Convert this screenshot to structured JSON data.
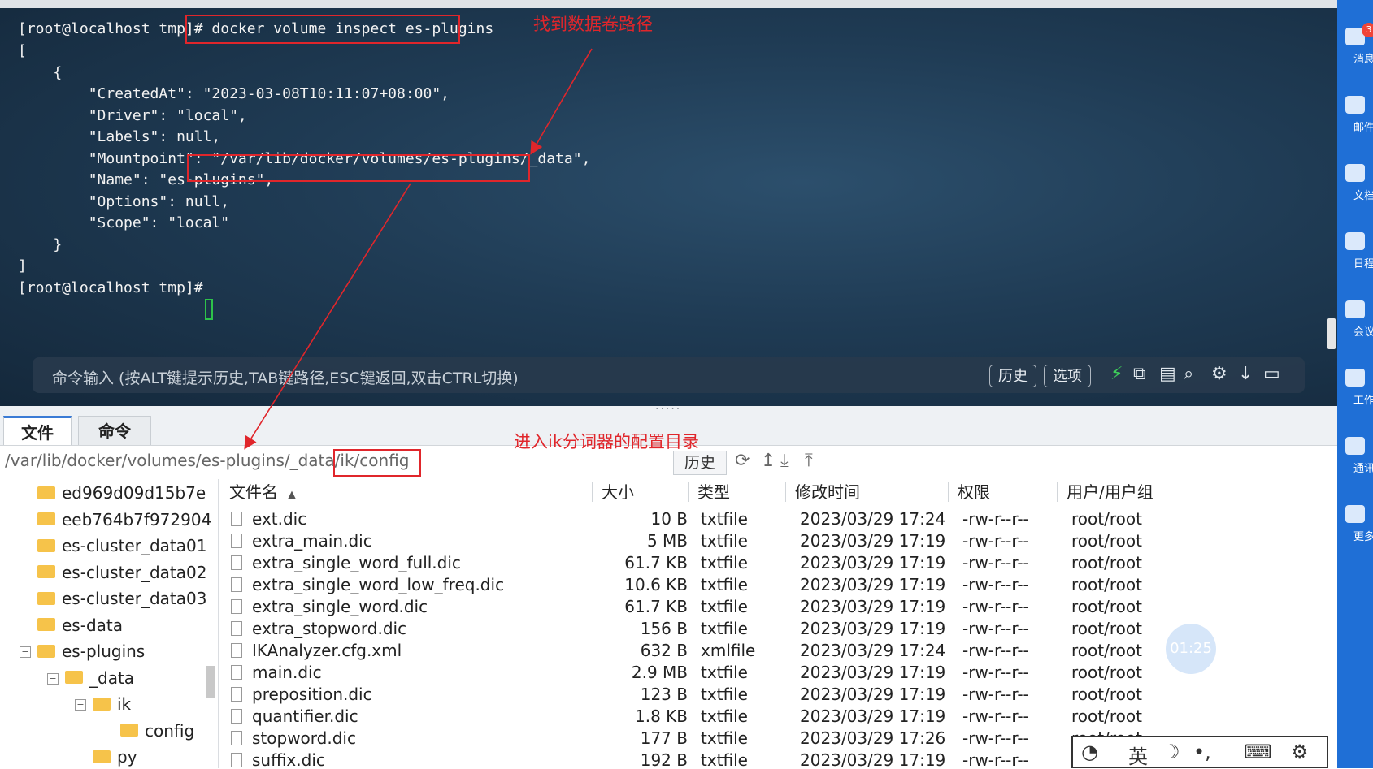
{
  "terminal": {
    "lines": [
      "[root@localhost tmp]# docker volume inspect es-plugins",
      "[",
      "    {",
      "        \"CreatedAt\": \"2023-03-08T10:11:07+08:00\",",
      "        \"Driver\": \"local\",",
      "        \"Labels\": null,",
      "        \"Mountpoint\": \"/var/lib/docker/volumes/es-plugins/_data\",",
      "        \"Name\": \"es-plugins\",",
      "        \"Options\": null,",
      "        \"Scope\": \"local\"",
      "    }",
      "]",
      "[root@localhost tmp]# "
    ],
    "annotation_top": "找到数据卷路径",
    "annotation_path": "进入ik分词器的配置目录",
    "command_placeholder": "命令输入 (按ALT键提示历史,TAB键路径,ESC键返回,双击CTRL切换)",
    "history_button": "历史",
    "options_button": "选项",
    "toolbar_icons": [
      "lightning-icon",
      "copy-icon",
      "paste-icon",
      "search-icon",
      "gear-icon",
      "download-arrow-icon",
      "maximize-icon"
    ]
  },
  "tabs": {
    "files": "文件",
    "commands": "命令"
  },
  "pathbar": {
    "path": "/var/lib/docker/volumes/es-plugins/_data/ik/config",
    "history": "历史"
  },
  "tree": [
    {
      "label": "ed969d09d15b7e"
    },
    {
      "label": "eeb764b7f972904"
    },
    {
      "label": "es-cluster_data01"
    },
    {
      "label": "es-cluster_data02"
    },
    {
      "label": "es-cluster_data03"
    },
    {
      "label": "es-data"
    },
    {
      "label": "es-plugins",
      "expander": "−"
    },
    {
      "label": "_data",
      "expander": "−"
    },
    {
      "label": "ik",
      "expander": "−"
    },
    {
      "label": "config",
      "selected": true
    },
    {
      "label": "py"
    }
  ],
  "filelist": {
    "columns": [
      "文件名",
      "大小",
      "类型",
      "修改时间",
      "权限",
      "用户/用户组"
    ],
    "sort_indicator": "▲",
    "rows": [
      {
        "name": "ext.dic",
        "size": "10 B",
        "type": "txtfile",
        "mtime": "2023/03/29 17:24",
        "perm": "-rw-r--r--",
        "owner": "root/root"
      },
      {
        "name": "extra_main.dic",
        "size": "5 MB",
        "type": "txtfile",
        "mtime": "2023/03/29 17:19",
        "perm": "-rw-r--r--",
        "owner": "root/root"
      },
      {
        "name": "extra_single_word_full.dic",
        "size": "61.7 KB",
        "type": "txtfile",
        "mtime": "2023/03/29 17:19",
        "perm": "-rw-r--r--",
        "owner": "root/root"
      },
      {
        "name": "extra_single_word_low_freq.dic",
        "size": "10.6 KB",
        "type": "txtfile",
        "mtime": "2023/03/29 17:19",
        "perm": "-rw-r--r--",
        "owner": "root/root"
      },
      {
        "name": "extra_single_word.dic",
        "size": "61.7 KB",
        "type": "txtfile",
        "mtime": "2023/03/29 17:19",
        "perm": "-rw-r--r--",
        "owner": "root/root"
      },
      {
        "name": "extra_stopword.dic",
        "size": "156 B",
        "type": "txtfile",
        "mtime": "2023/03/29 17:19",
        "perm": "-rw-r--r--",
        "owner": "root/root"
      },
      {
        "name": "IKAnalyzer.cfg.xml",
        "size": "632 B",
        "type": "xmlfile",
        "mtime": "2023/03/29 17:24",
        "perm": "-rw-r--r--",
        "owner": "root/root"
      },
      {
        "name": "main.dic",
        "size": "2.9 MB",
        "type": "txtfile",
        "mtime": "2023/03/29 17:19",
        "perm": "-rw-r--r--",
        "owner": "root/root"
      },
      {
        "name": "preposition.dic",
        "size": "123 B",
        "type": "txtfile",
        "mtime": "2023/03/29 17:19",
        "perm": "-rw-r--r--",
        "owner": "root/root"
      },
      {
        "name": "quantifier.dic",
        "size": "1.8 KB",
        "type": "txtfile",
        "mtime": "2023/03/29 17:19",
        "perm": "-rw-r--r--",
        "owner": "root/root"
      },
      {
        "name": "stopword.dic",
        "size": "177 B",
        "type": "txtfile",
        "mtime": "2023/03/29 17:26",
        "perm": "-rw-r--r--",
        "owner": "root/root"
      },
      {
        "name": "suffix.dic",
        "size": "192 B",
        "type": "txtfile",
        "mtime": "2023/03/29 17:19",
        "perm": "-rw-r--r--",
        "owner": ""
      }
    ]
  },
  "overlay": {
    "timer": "01:25",
    "ime_lang": "英"
  },
  "sidebar": [
    {
      "label": "消息",
      "badge": "3"
    },
    {
      "label": "邮件",
      "badge": ""
    },
    {
      "label": "文档",
      "badge": ""
    },
    {
      "label": "日程",
      "badge": ""
    },
    {
      "label": "会议",
      "badge": ""
    },
    {
      "label": "工作",
      "badge": ""
    },
    {
      "label": "通讯",
      "badge": ""
    },
    {
      "label": "更多",
      "badge": ""
    }
  ],
  "colors": {
    "annotation": "#e0262b",
    "sidebar": "#1f6fd6",
    "cursor": "#2ec24a"
  }
}
